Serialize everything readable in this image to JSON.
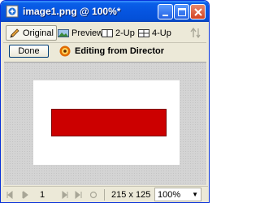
{
  "window": {
    "title": "image1.png @ 100%*"
  },
  "tabs": [
    {
      "label": "Original",
      "icon": "pencil-icon",
      "active": true
    },
    {
      "label": "Preview",
      "icon": "preview-icon",
      "active": false
    },
    {
      "label": "2-Up",
      "icon": "two-up-icon",
      "active": false
    },
    {
      "label": "4-Up",
      "icon": "four-up-icon",
      "active": false
    }
  ],
  "editbar": {
    "done_label": "Done",
    "editing_text": "Editing from Director"
  },
  "status": {
    "frame": "1",
    "dimensions": "215 x 125",
    "zoom": "100%"
  },
  "colors": {
    "titlebar": "#0655e0",
    "canvas_background": "#d4d4d4",
    "image_fill": "#cc0000"
  }
}
